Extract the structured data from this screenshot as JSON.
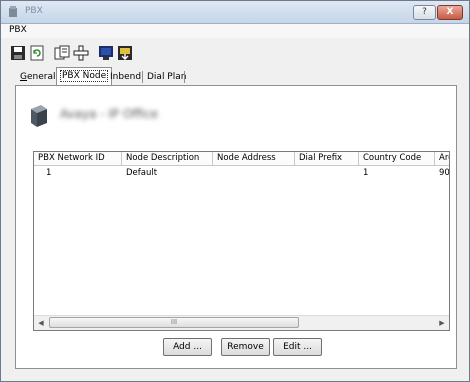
{
  "window": {
    "title": "PBX",
    "help_label": "?",
    "close_label": "X"
  },
  "menu": {
    "label": "PBX"
  },
  "toolbar": {
    "icons": [
      "save-icon",
      "refresh-icon",
      "copy-icon",
      "add-icon",
      "monitor-icon",
      "import-icon"
    ]
  },
  "tabs": [
    {
      "label": "General",
      "underline_char": "G",
      "rest": "eneral",
      "active": false
    },
    {
      "label": "PBX Node",
      "underline_char": "",
      "rest": "PBX Node",
      "active": true
    },
    {
      "label": "Inbend",
      "underline_char": "",
      "rest": "Inbend",
      "active": false
    },
    {
      "label": "Dial Plan",
      "underline_char": "",
      "rest": "Dial Plan",
      "active": false
    }
  ],
  "node_header": {
    "name": "Avaya - IP Office"
  },
  "table": {
    "columns": [
      "PBX Network ID",
      "Node Description",
      "Node Address",
      "Dial Prefix",
      "Country Code",
      "Are"
    ],
    "rows": [
      {
        "pbx_network_id": "1",
        "node_description": "Default",
        "node_address": "",
        "dial_prefix": "",
        "country_code": "1",
        "area": "90"
      }
    ],
    "scroll_thumb_glyph": "III"
  },
  "buttons": {
    "add": "Add ...",
    "remove": "Remove",
    "edit": "Edit ..."
  },
  "colors": {
    "title_gradient_top": "#dfe8f3",
    "close_red": "#c95a43",
    "panel_bg": "#ffffff"
  }
}
